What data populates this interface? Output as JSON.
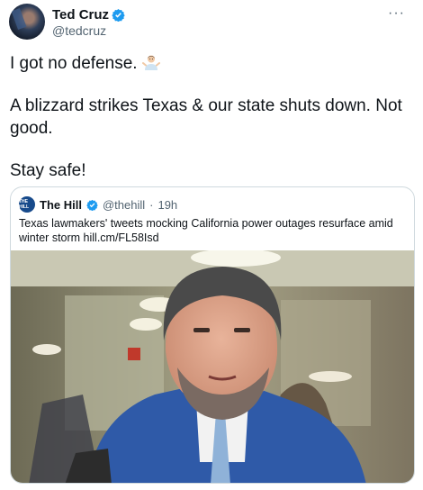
{
  "author": {
    "display_name": "Ted Cruz",
    "handle": "@tedcruz",
    "verified_icon": "verified-badge-icon"
  },
  "more_icon": "···",
  "tweet": {
    "line1": "I got no defense.",
    "line1_emoji": "person-shrugging-emoji",
    "line2": "A blizzard strikes Texas & our state shuts down. Not good.",
    "line3": "Stay safe!"
  },
  "quoted": {
    "logo_text": "THE HILL",
    "name": "The Hill",
    "handle": "@thehill",
    "separator": "·",
    "time": "19h",
    "text": "Texas lawmakers' tweets mocking California power outages resurface amid winter storm hill.cm/FL58Isd",
    "image": "photo-of-ted-cruz-in-hallway"
  },
  "colors": {
    "verified_blue": "#1d9bf0",
    "secondary_text": "#536471",
    "border": "#cfd9de",
    "suit_blue": "#2f5aa8"
  }
}
